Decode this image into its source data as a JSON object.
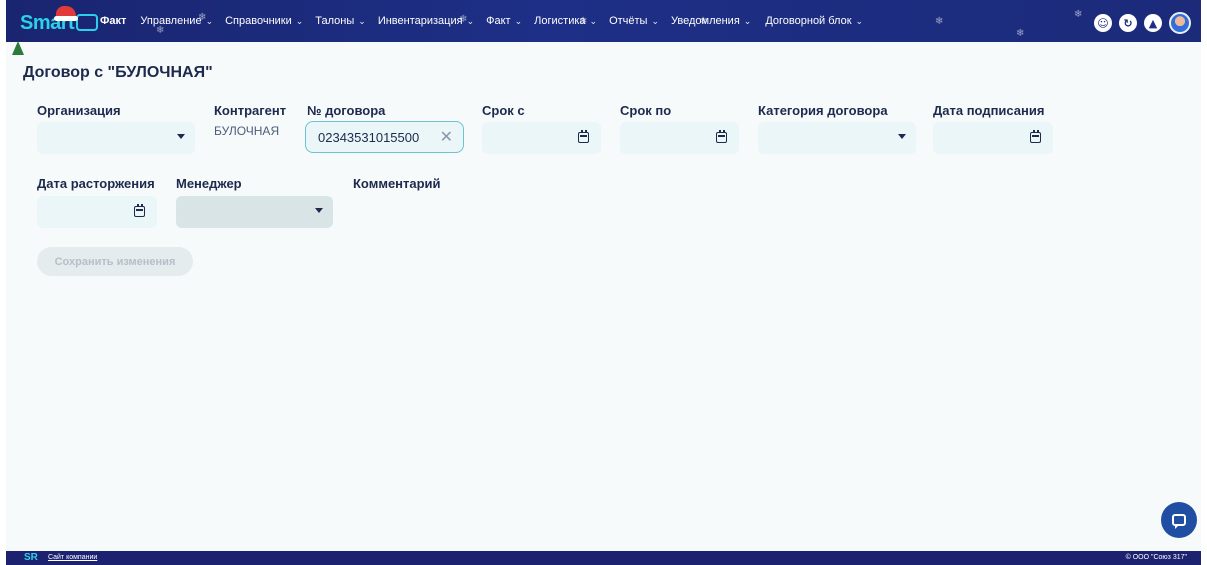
{
  "nav": {
    "logo_text": "Smart",
    "items": [
      {
        "label": "Факт",
        "bold": true,
        "chevron": false
      },
      {
        "label": "Управление",
        "chevron": true
      },
      {
        "label": "Справочники",
        "chevron": true
      },
      {
        "label": "Талоны",
        "chevron": true
      },
      {
        "label": "Инвентаризация",
        "chevron": true
      },
      {
        "label": "Факт",
        "chevron": true
      },
      {
        "label": "Логистика",
        "chevron": true
      },
      {
        "label": "Отчёты",
        "chevron": true
      },
      {
        "label": "Уведомления",
        "chevron": true
      },
      {
        "label": "Договорной блок",
        "chevron": true
      }
    ],
    "chevron_glyph": "⌄",
    "icons": [
      "support-icon",
      "refresh-icon",
      "bell-icon",
      "user-avatar"
    ]
  },
  "page": {
    "title": "Договор с \"БУЛОЧНАЯ\""
  },
  "form": {
    "organization_label": "Организация",
    "counterparty_label": "Контрагент",
    "counterparty_value": "БУЛОЧНАЯ",
    "contract_number_label": "№ договора",
    "contract_number_value": "02343531015500",
    "date_from_label": "Срок с",
    "date_to_label": "Срок по",
    "category_label": "Категория договора",
    "sign_date_label": "Дата подписания",
    "termination_date_label": "Дата расторжения",
    "manager_label": "Менеджер",
    "comment_label": "Комментарий",
    "save_label": "Сохранить изменения"
  },
  "footer": {
    "logo": "SR",
    "link": "Сайт компании",
    "copyright": "© ООО \"Союз 317\""
  },
  "colors": {
    "nav_bg": "#1d2f86",
    "accent": "#2bd1e8",
    "field_bg": "#eaf6f8",
    "footer_bg": "#1d2270",
    "chat_button": "#1f4ea3"
  }
}
